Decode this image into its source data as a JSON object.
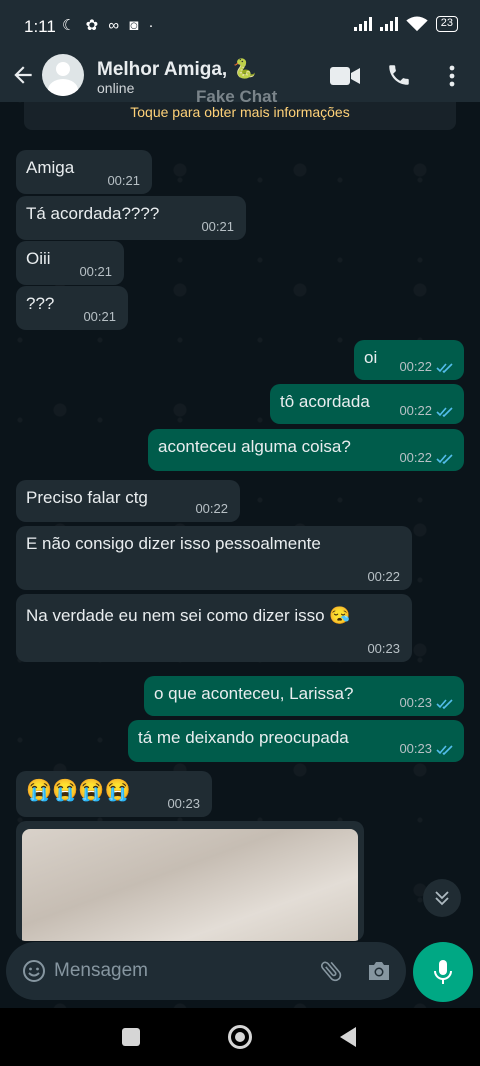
{
  "status_bar": {
    "time": "1:11",
    "battery": "23"
  },
  "header": {
    "contact_name": "Melhor Amiga, 🐍",
    "status": "online"
  },
  "banner": {
    "text": "Toque para obter mais informações"
  },
  "watermark": "Fake Chat",
  "messages": [
    {
      "dir": "in",
      "text": "Amiga",
      "time": "00:21"
    },
    {
      "dir": "in",
      "text": "Tá acordada????",
      "time": "00:21"
    },
    {
      "dir": "in",
      "text": "Oiii",
      "time": "00:21"
    },
    {
      "dir": "in",
      "text": "???",
      "time": "00:21"
    },
    {
      "dir": "out",
      "text": "oi",
      "time": "00:22"
    },
    {
      "dir": "out",
      "text": "tô acordada",
      "time": "00:22"
    },
    {
      "dir": "out",
      "text": "aconteceu alguma coisa?",
      "time": "00:22"
    },
    {
      "dir": "in",
      "text": "Preciso falar ctg",
      "time": "00:22"
    },
    {
      "dir": "in",
      "text": "E não consigo dizer isso pessoalmente",
      "time": "00:22"
    },
    {
      "dir": "in",
      "text": "Na verdade eu nem sei como dizer isso 😪",
      "time": "00:23"
    },
    {
      "dir": "out",
      "text": "o que aconteceu, Larissa?",
      "time": "00:23"
    },
    {
      "dir": "out",
      "text": "tá me deixando preocupada",
      "time": "00:23"
    },
    {
      "dir": "in",
      "text": "😭😭😭😭",
      "time": "00:23"
    }
  ],
  "input": {
    "placeholder": "Mensagem"
  },
  "colors": {
    "incoming": "#202c33",
    "outgoing": "#005c4b",
    "accent": "#00a884",
    "read_ticks": "#53bdeb"
  }
}
